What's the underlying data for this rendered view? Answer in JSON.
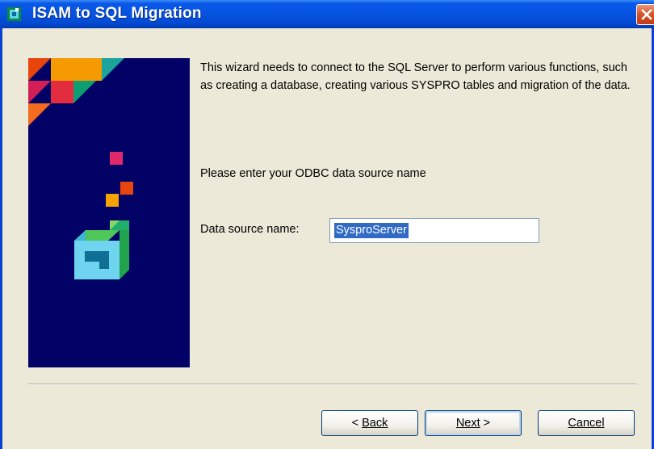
{
  "window": {
    "title": "ISAM to SQL Migration"
  },
  "content": {
    "intro_text": "This wizard needs to connect to the SQL Server to perform various functions, such as creating a database, creating various SYSPRO tables and migration of the data.",
    "prompt_text": "Please enter your ODBC data source name",
    "dsn_label": "Data source name:",
    "dsn_value": "SysproServer"
  },
  "buttons": {
    "back_label": "Back",
    "back_prefix": "< ",
    "next_label": "Next",
    "next_suffix": " >",
    "cancel_label": "Cancel"
  },
  "colors": {
    "titlebar": "#0653DF",
    "dialog_bg": "#ECE9D8",
    "banner_bg": "#020266",
    "selection": "#316AC5"
  }
}
